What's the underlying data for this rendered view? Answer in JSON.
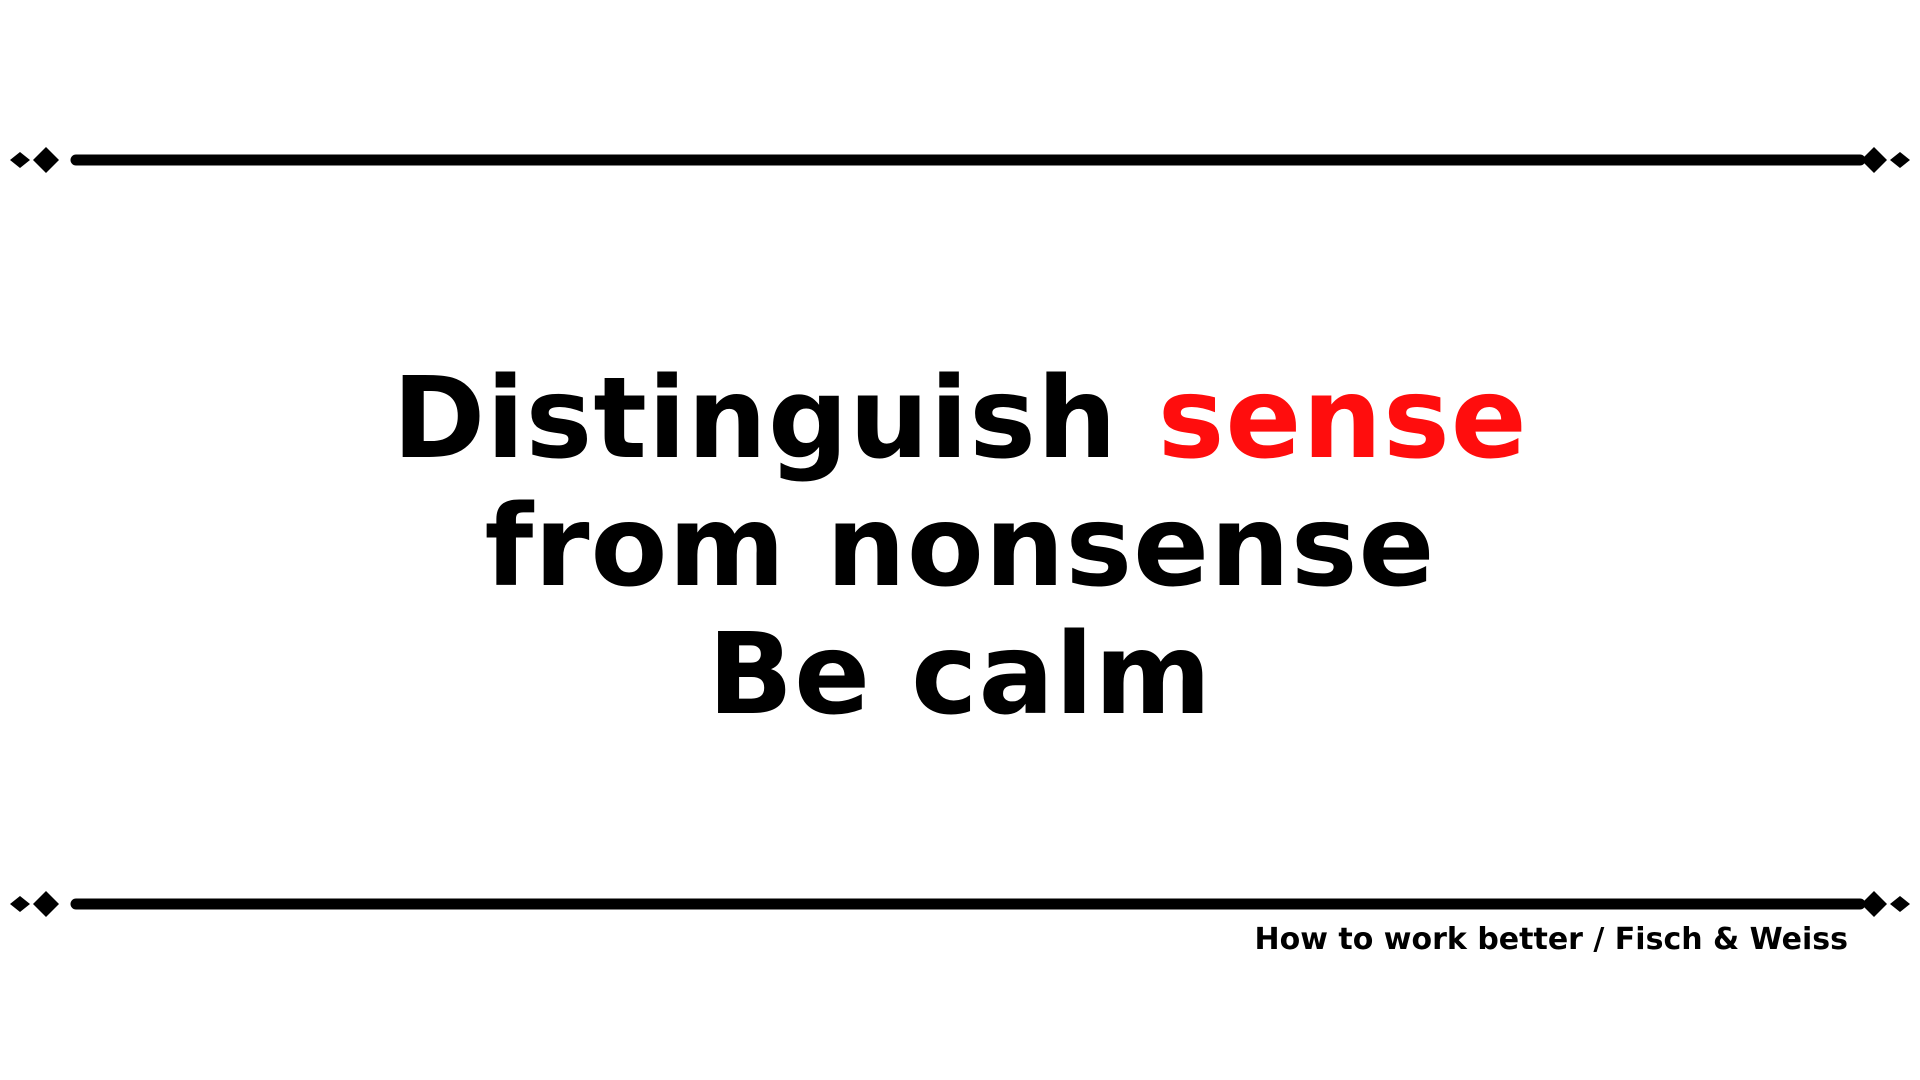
{
  "headline": {
    "line1_lead": "Distinguish",
    "line1_accent": "sense",
    "line2": "from nonsense",
    "line3": "Be calm"
  },
  "credit": "How to work better / Fisch & Weiss",
  "colors": {
    "text": "#000000",
    "accent": "#ff0d0d",
    "background": "#ffffff"
  },
  "icons": {
    "rule_end": "diamond-pair-icon"
  }
}
